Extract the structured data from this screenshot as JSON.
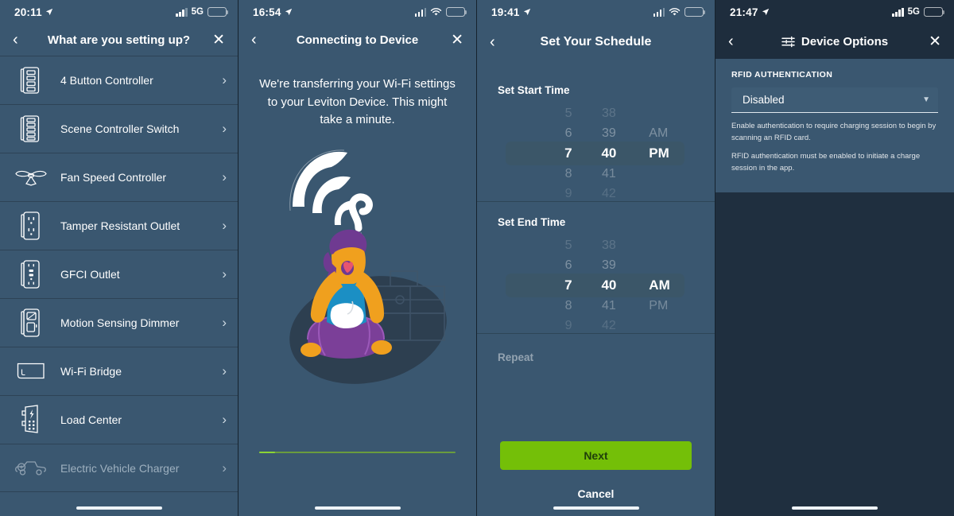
{
  "panels": [
    {
      "status": {
        "time": "20:11",
        "network": "5G",
        "battery_style": "white"
      },
      "nav": {
        "back": "‹",
        "title": "What are you setting up?",
        "close": "✕"
      },
      "list": [
        {
          "label": "4 Button Controller",
          "icon": "button-controller-icon",
          "chevron": "›",
          "disabled": false
        },
        {
          "label": "Scene Controller Switch",
          "icon": "scene-controller-icon",
          "chevron": "›",
          "disabled": false
        },
        {
          "label": "Fan Speed Controller",
          "icon": "ceiling-fan-icon",
          "chevron": "›",
          "disabled": false
        },
        {
          "label": "Tamper Resistant Outlet",
          "icon": "outlet-icon",
          "chevron": "›",
          "disabled": false
        },
        {
          "label": "GFCI Outlet",
          "icon": "gfci-outlet-icon",
          "chevron": "›",
          "disabled": false
        },
        {
          "label": "Motion Sensing Dimmer",
          "icon": "motion-dimmer-icon",
          "chevron": "›",
          "disabled": false
        },
        {
          "label": "Wi-Fi Bridge",
          "icon": "wifi-bridge-icon",
          "chevron": "›",
          "disabled": false
        },
        {
          "label": "Load Center",
          "icon": "load-center-icon",
          "chevron": "›",
          "disabled": false
        },
        {
          "label": "Electric Vehicle Charger",
          "icon": "ev-charger-icon",
          "chevron": "›",
          "disabled": true
        }
      ]
    },
    {
      "status": {
        "time": "16:54",
        "network": "wifi",
        "battery_style": "white-low"
      },
      "nav": {
        "back": "‹",
        "title": "Connecting to Device",
        "close": "✕"
      },
      "message": "We're transferring your Wi-Fi settings to your Leviton Device. This might take a minute.",
      "progress": {
        "percent": 8,
        "track_color": "#6a9c3e",
        "fill_color": "#8cd434"
      }
    },
    {
      "status": {
        "time": "19:41",
        "network": "wifi",
        "battery_style": "white"
      },
      "nav": {
        "back": "‹",
        "title": "Set Your Schedule",
        "close": ""
      },
      "start": {
        "heading": "Set Start Time",
        "hours": [
          "5",
          "6",
          "7",
          "8",
          "9"
        ],
        "minutes": [
          "38",
          "39",
          "40",
          "41",
          "42"
        ],
        "meridiem": [
          "",
          "AM",
          "PM",
          "",
          ""
        ],
        "selected_hour": "7",
        "selected_minute": "40",
        "selected_meridiem": "PM"
      },
      "end": {
        "heading": "Set End Time",
        "hours": [
          "5",
          "6",
          "7",
          "8",
          "9"
        ],
        "minutes": [
          "38",
          "39",
          "40",
          "41",
          "42"
        ],
        "meridiem": [
          "",
          "",
          "AM",
          "PM",
          ""
        ],
        "selected_hour": "7",
        "selected_minute": "40",
        "selected_meridiem": "AM"
      },
      "repeat_label": "Repeat",
      "next_label": "Next",
      "cancel_label": "Cancel",
      "next_color": "#74bf08"
    },
    {
      "status": {
        "time": "21:47",
        "network": "5G",
        "battery_style": "yellow"
      },
      "nav": {
        "back": "‹",
        "title": "Device Options",
        "close": "✕",
        "icon": "sliders-icon"
      },
      "section_label": "RFID AUTHENTICATION",
      "select_value": "Disabled",
      "help_1": "Enable authentication to require charging session to begin by scanning an RFID card.",
      "help_2": "RFID authentication must be enabled to initiate a charge session in the app."
    }
  ]
}
